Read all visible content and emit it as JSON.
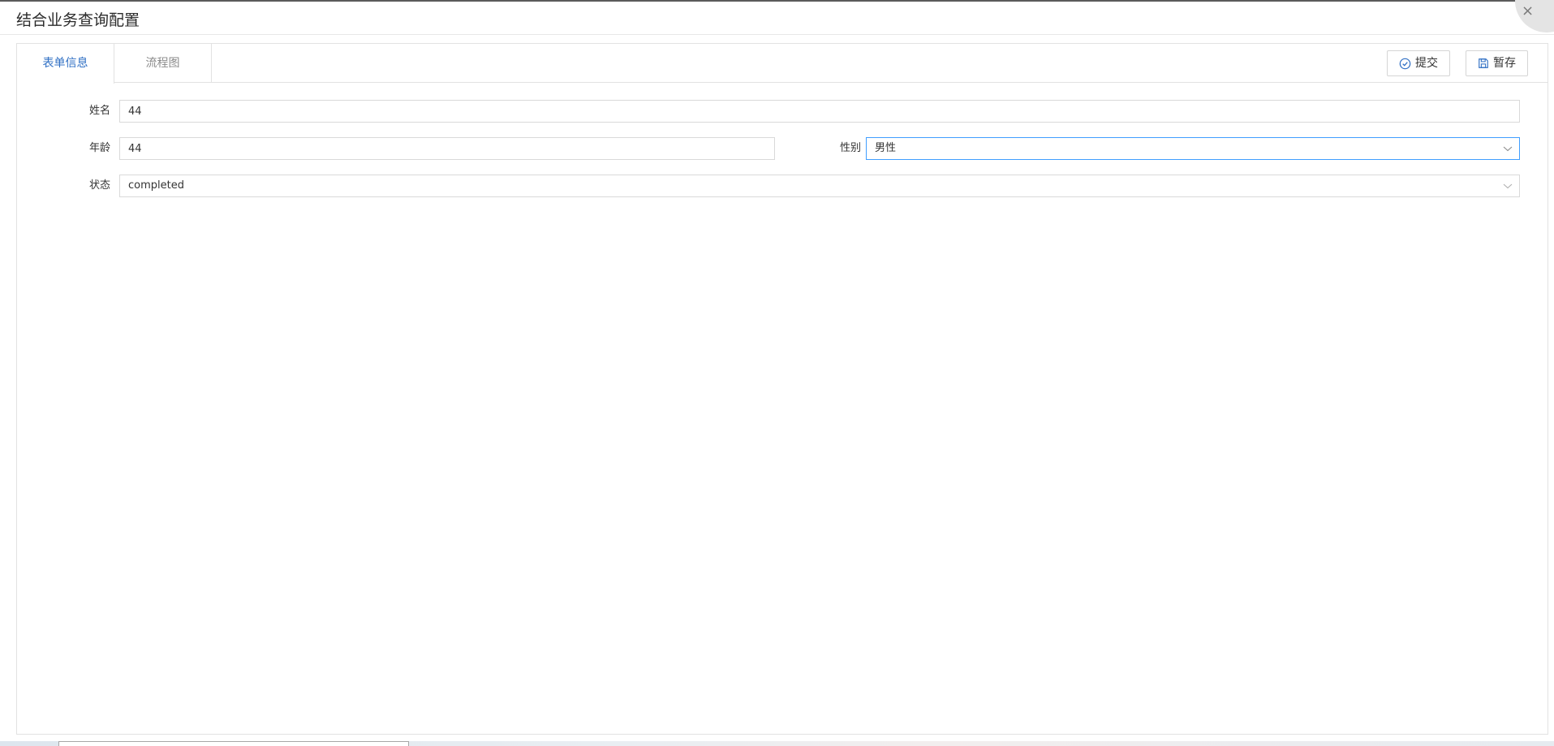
{
  "window": {
    "title": "结合业务查询配置",
    "close_symbol": "×"
  },
  "tabs": [
    {
      "label": "表单信息",
      "active": true
    },
    {
      "label": "流程图",
      "active": false
    }
  ],
  "toolbar": {
    "submit_label": "提交",
    "save_draft_label": "暂存",
    "submit_icon": "check-circle-icon",
    "save_icon": "save-icon"
  },
  "form": {
    "name": {
      "label": "姓名",
      "value": "44"
    },
    "age": {
      "label": "年龄",
      "value": "44"
    },
    "gender": {
      "label": "性别",
      "value": "男性"
    },
    "status": {
      "label": "状态",
      "value": "completed"
    }
  },
  "colors": {
    "accent": "#2f6fc4",
    "focus_border": "#409eff"
  }
}
